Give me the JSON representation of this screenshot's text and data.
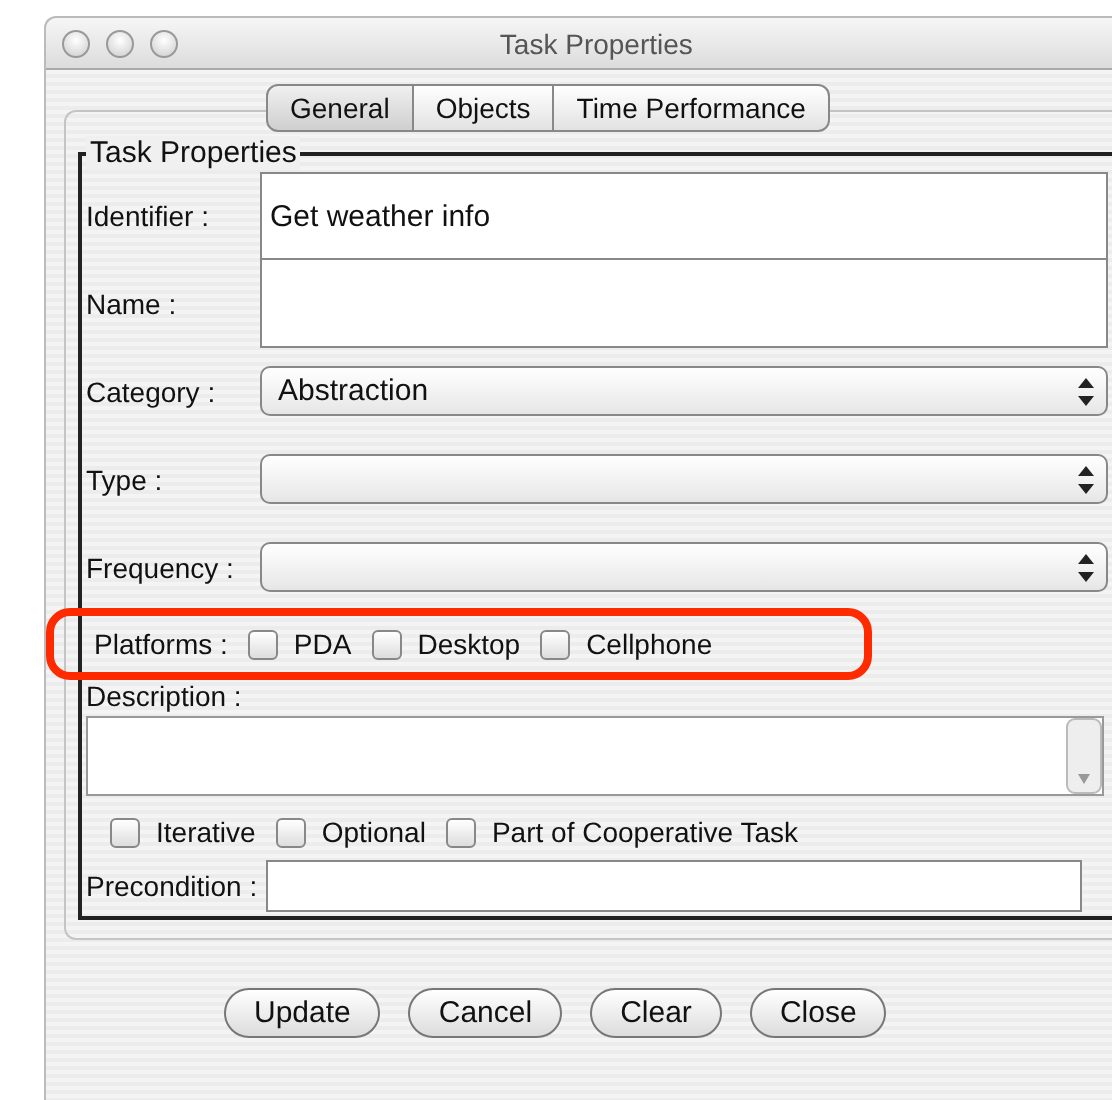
{
  "window": {
    "title": "Task Properties"
  },
  "tabs": [
    {
      "label": "General",
      "selected": true
    },
    {
      "label": "Objects",
      "selected": false
    },
    {
      "label": "Time Performance",
      "selected": false
    }
  ],
  "group": {
    "title": "Task Properties"
  },
  "identifier": {
    "label": "Identifier :",
    "value": "Get weather info"
  },
  "name": {
    "label": "Name :"
  },
  "selects": [
    {
      "label": "Category :",
      "value": "Abstraction"
    },
    {
      "label": "Type :"
    },
    {
      "label": "Frequency :"
    }
  ],
  "platforms": {
    "label": "Platforms :",
    "highlighted": true,
    "options": [
      {
        "label": "PDA",
        "checked": false
      },
      {
        "label": "Desktop",
        "checked": false
      },
      {
        "label": "Cellphone",
        "checked": false
      }
    ]
  },
  "description": {
    "label": "Description :"
  },
  "flags": [
    {
      "label": "Iterative",
      "checked": false
    },
    {
      "label": "Optional",
      "checked": false
    },
    {
      "label": "Part of Cooperative Task",
      "checked": false
    }
  ],
  "precondition": {
    "label": "Precondition :"
  },
  "buttons": [
    "Update",
    "Cancel",
    "Clear",
    "Close"
  ]
}
